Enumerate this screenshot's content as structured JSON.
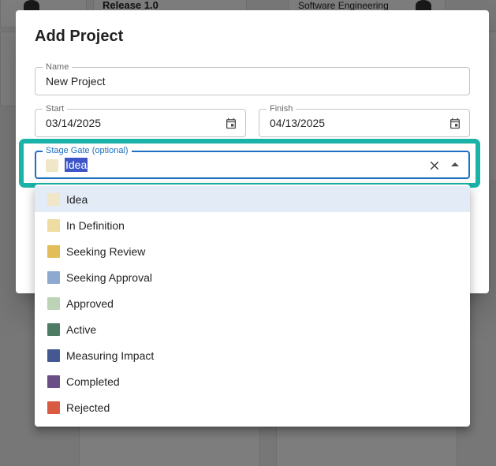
{
  "background": {
    "card1_title": "Release 1.0",
    "card2_title": "Software Engineering"
  },
  "dialog": {
    "title": "Add Project",
    "name": {
      "label": "Name",
      "value": "New Project"
    },
    "start": {
      "label": "Start",
      "value": "03/14/2025"
    },
    "finish": {
      "label": "Finish",
      "value": "04/13/2025"
    },
    "stage_gate": {
      "label": "Stage Gate (optional)",
      "value": "Idea",
      "color": "#f0e6c8"
    }
  },
  "options": [
    {
      "label": "Idea",
      "color": "#f0e6c8",
      "selected": true
    },
    {
      "label": "In Definition",
      "color": "#efdca3"
    },
    {
      "label": "Seeking Review",
      "color": "#e2bd5a"
    },
    {
      "label": "Seeking Approval",
      "color": "#8ea9cf"
    },
    {
      "label": "Approved",
      "color": "#bcd3b6"
    },
    {
      "label": "Active",
      "color": "#4e7b63"
    },
    {
      "label": "Measuring Impact",
      "color": "#455892"
    },
    {
      "label": "Completed",
      "color": "#6a4e86"
    },
    {
      "label": "Rejected",
      "color": "#d95a43"
    }
  ],
  "colors": {
    "accent": "#1e6fc0",
    "highlight_ring": "#1bb3a8",
    "text_selection": "#3d55c9"
  }
}
